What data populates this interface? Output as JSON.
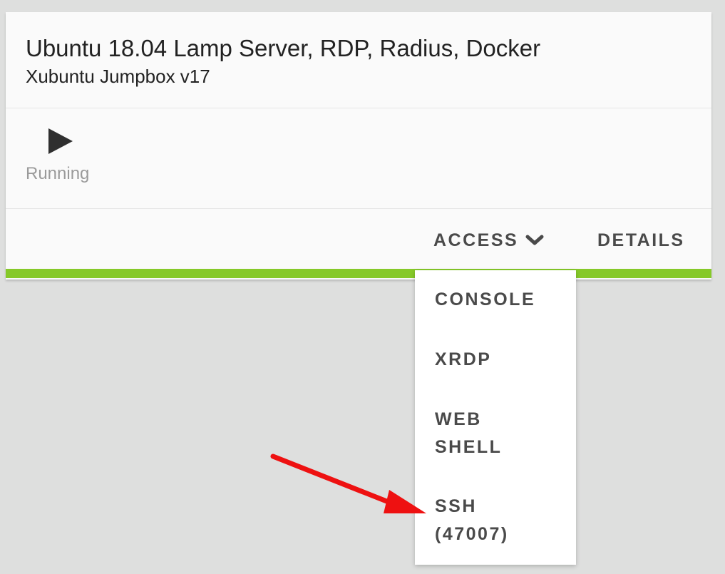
{
  "vm": {
    "title": "Ubuntu 18.04 Lamp Server, RDP, Radius, Docker",
    "subtitle": "Xubuntu Jumpbox v17",
    "status": "Running",
    "status_icon": "play-icon"
  },
  "actions": {
    "access_label": "ACCESS",
    "access_icon": "chevron-down-icon",
    "details_label": "DETAILS"
  },
  "access_menu": {
    "items": [
      {
        "label_lines": [
          "CONSOLE"
        ]
      },
      {
        "label_lines": [
          "XRDP"
        ]
      },
      {
        "label_lines": [
          "WEB",
          "SHELL"
        ]
      },
      {
        "label_lines": [
          "SSH",
          "(47007)"
        ]
      }
    ]
  },
  "colors": {
    "background": "#dedfde",
    "card": "#fafafa",
    "status_stripe": "#86c929",
    "text_primary": "#222222",
    "text_muted": "#9a9a9a",
    "action_text": "#4a4a4a",
    "annotation_arrow": "#ee1111"
  }
}
